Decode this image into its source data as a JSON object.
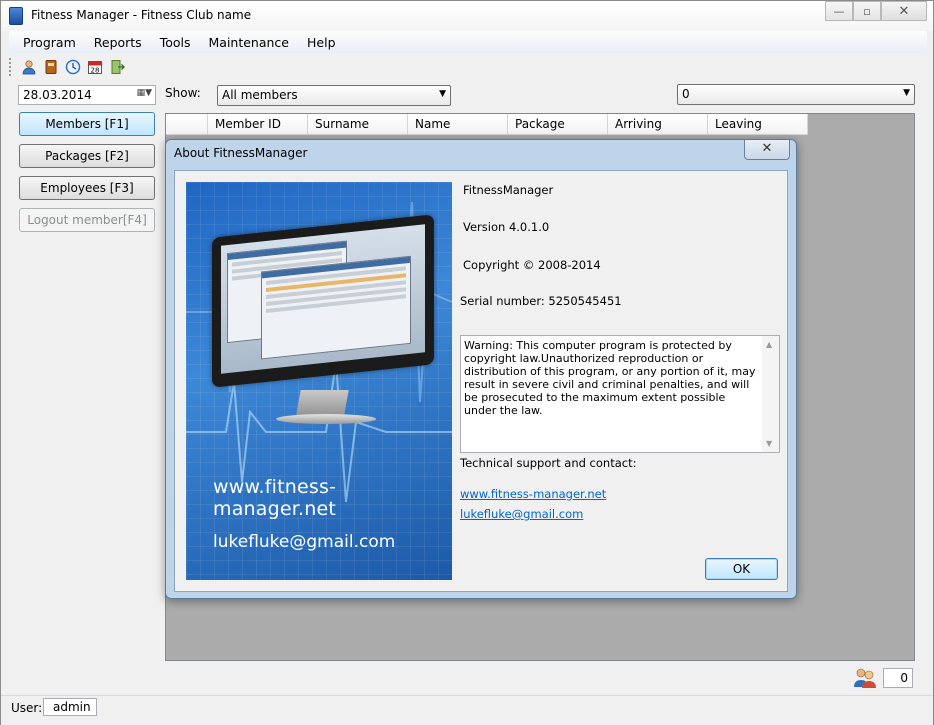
{
  "window": {
    "title": "Fitness Manager - Fitness Club name",
    "controls": {
      "minimize": "—",
      "maximize": "▫",
      "close": "✕"
    }
  },
  "menu": [
    "Program",
    "Reports",
    "Tools",
    "Maintenance",
    "Help"
  ],
  "toolbar": {
    "icons": [
      "person-add-icon",
      "book-icon",
      "clock-icon",
      "calendar-icon",
      "exit-icon"
    ],
    "calendar_text": "28"
  },
  "left_panel": {
    "date": "28.03.2014",
    "buttons": [
      "Members [F1]",
      "Packages [F2]",
      "Employees [F3]",
      "Logout member[F4]"
    ]
  },
  "filter": {
    "show_label": "Show:",
    "show_value": "All members",
    "right_combo_value": "0"
  },
  "grid": {
    "columns": [
      "",
      "Member ID",
      "Surname",
      "Name",
      "Package",
      "Arriving",
      "Leaving"
    ]
  },
  "status": {
    "user_label": "User:",
    "user_value": "admin",
    "count": "0"
  },
  "dialog": {
    "title": "About FitnessManager",
    "close": "✕",
    "product": "FitnessManager",
    "version": "Version 4.0.1.0",
    "copyright": "Copyright © 2008-2014",
    "serial": "Serial number: 5250545451",
    "warning": "Warning: This computer program is protected by copyright law.Unauthorized reproduction or distribution of this program, or any portion of it, may result in severe civil and criminal penalties, and will be prosecuted to the maximum extent possible under the law.",
    "support_label": "Technical support and contact:",
    "website": "www.fitness-manager.net",
    "email": "lukefluke@gmail.com",
    "ok": "OK",
    "splash_url": "www.fitness-manager.net",
    "splash_email": "lukefluke@gmail.com"
  }
}
